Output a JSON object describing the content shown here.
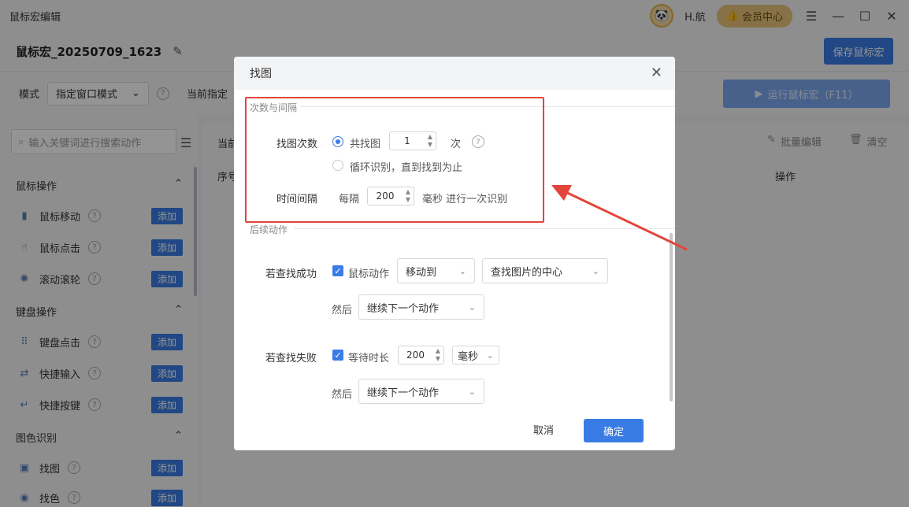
{
  "app": {
    "title": "鼠标宏编辑",
    "username": "H.航",
    "vip_label": "会员中心",
    "window_controls": [
      "menu-icon",
      "minimize-icon",
      "maximize-icon",
      "close-icon"
    ]
  },
  "header": {
    "macro_name": "鼠标宏_20250709_1623",
    "save_label": "保存鼠标宏"
  },
  "toolbar": {
    "mode_label": "模式",
    "mode_value": "指定窗口模式",
    "current_label": "当前指定",
    "run_label": "运行鼠标宏（F11）"
  },
  "sidebar": {
    "search_placeholder": "输入关键词进行搜索动作",
    "add_label": "添加",
    "groups": [
      {
        "label": "鼠标操作",
        "items": [
          "鼠标移动",
          "鼠标点击",
          "滚动滚轮"
        ]
      },
      {
        "label": "键盘操作",
        "items": [
          "键盘点击",
          "快捷输入",
          "快捷按键"
        ]
      },
      {
        "label": "图色识别",
        "items": [
          "找图",
          "找色"
        ]
      }
    ]
  },
  "main": {
    "current_label": "当前",
    "batch_edit": "批量编辑",
    "clear": "清空",
    "col_index": "序号",
    "col_action": "操作"
  },
  "dialog": {
    "title": "找图",
    "section1": "次数与间隔",
    "count_label": "找图次数",
    "opt_total": "共找图",
    "count_value": "1",
    "count_unit": "次",
    "opt_loop": "循环识别，直到找到为止",
    "interval_label": "时间间隔",
    "interval_prefix": "每隔",
    "interval_value": "200",
    "interval_suffix": "毫秒 进行一次识别",
    "section2": "后续动作",
    "success_label": "若查找成功",
    "mouse_action": "鼠标动作",
    "move_to": "移动到",
    "target": "查找图片的中心",
    "then_label": "然后",
    "next_action": "继续下一个动作",
    "fail_label": "若查找失败",
    "wait_label": "等待时长",
    "wait_value": "200",
    "wait_unit": "毫秒",
    "cancel": "取消",
    "confirm": "确定"
  }
}
